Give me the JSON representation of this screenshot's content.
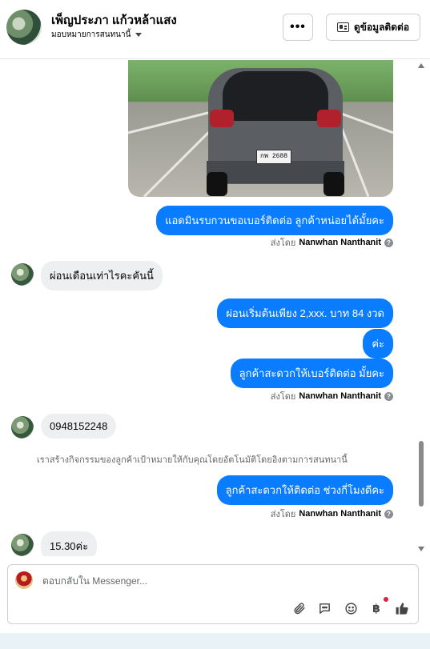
{
  "header": {
    "name": "เพ็ญประภา แก้วหล้าแสง",
    "assign_label": "มอบหมายการสนทนานี้",
    "more_label": "•••",
    "contact_label": "ดูข้อมูลติดต่อ"
  },
  "thread": {
    "car_plate": "กพ 2688",
    "messages": [
      {
        "text": "แอดมินรบกวนขอเบอร์ติดต่อ ลูกค้าหน่อยได้มั้ยคะ"
      },
      {
        "text": "ผ่อนเดือนเท่าไรคะคันนี้"
      },
      {
        "text": "ผ่อนเริ่มต้นเพียง 2,xxx. บาท 84 งวด"
      },
      {
        "text": "ค่ะ"
      },
      {
        "text": "ลูกค้าสะดวกให้เบอร์ติดต่อ มั้ยคะ"
      },
      {
        "text": "0948152248"
      },
      {
        "text": "ลูกค้าสะดวกให้ติดต่อ ช่วงกี่โมงดีคะ"
      },
      {
        "text": "15.30ค่ะ"
      }
    ],
    "sent_by_prefix": "ส่งโดย",
    "sent_by_name": "Nanwhan Nanthanit",
    "system_note": "เราสร้างกิจกรรมของลูกค้าเป้าหมายให้กับคุณโดยอัตโนมัติโดยอิงตามการสนทนานี้"
  },
  "composer": {
    "placeholder": "ตอบกลับใน Messenger..."
  },
  "icons": {
    "attach": "paperclip-icon",
    "saved_replies": "chat-bubble-icon",
    "emoji": "smiley-icon",
    "payment": "baht-icon",
    "like": "thumbs-up-icon"
  },
  "colors": {
    "outgoing_bubble": "#0a7cff",
    "incoming_bubble": "#eeeff1",
    "notification_dot": "#e41e3f"
  }
}
